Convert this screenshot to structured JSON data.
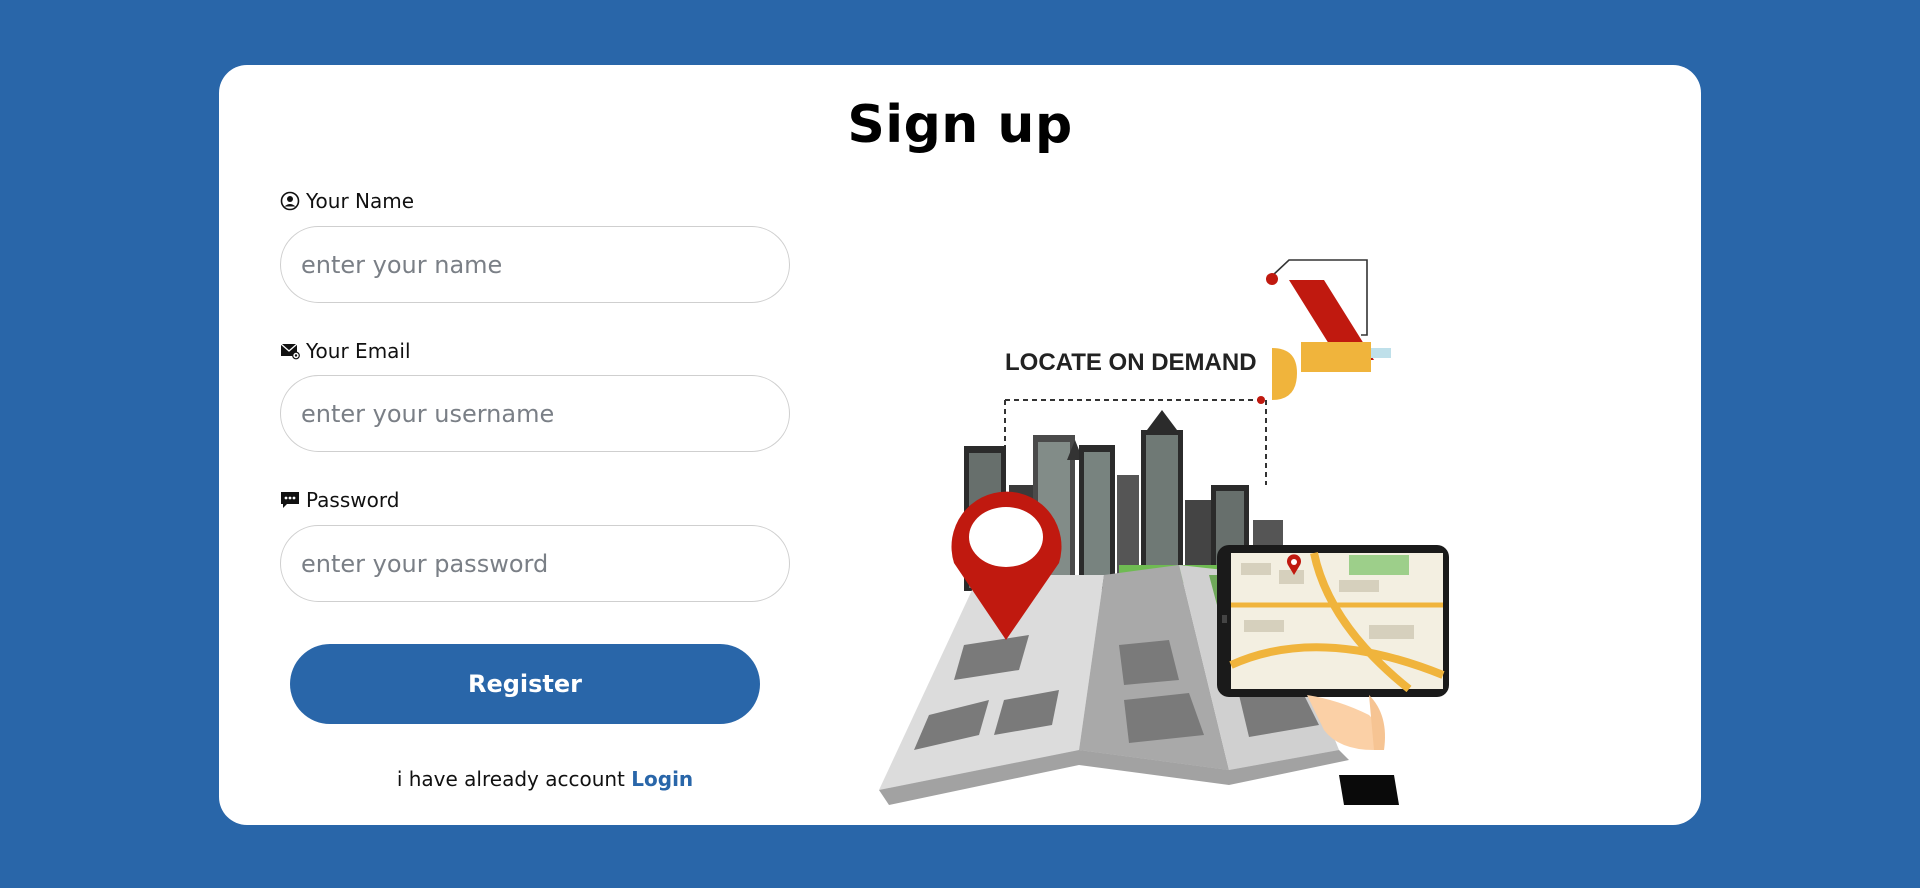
{
  "page": {
    "title": "Sign up"
  },
  "form": {
    "name": {
      "label": "Your Name",
      "placeholder": "enter your name",
      "value": ""
    },
    "email": {
      "label": "Your Email",
      "placeholder": "enter your username",
      "value": ""
    },
    "password": {
      "label": "Password",
      "placeholder": "enter your password",
      "value": ""
    },
    "register_label": "Register"
  },
  "footer": {
    "text": "i have already account",
    "login_label": "Login"
  },
  "illustration": {
    "caption": "LOCATE ON DEMAND"
  },
  "colors": {
    "background": "#2966a9",
    "accent": "#2966a9",
    "pin": "#c0190f",
    "satellite": "#f0b43c"
  },
  "icons": {
    "name": "user-circle-icon",
    "email": "envelope-icon",
    "password": "chat-bubble-icon"
  }
}
